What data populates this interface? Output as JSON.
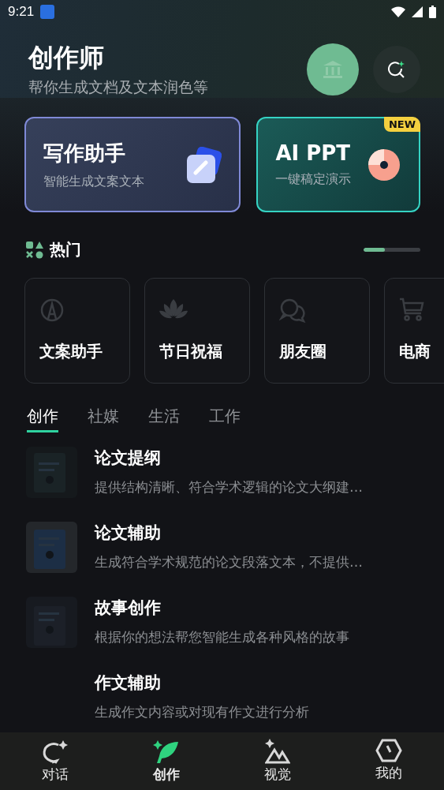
{
  "status_bar": {
    "time": "9:21"
  },
  "header": {
    "title": "创作师",
    "subtitle": "帮你生成文档及文本润色等"
  },
  "feature_cards": [
    {
      "kind": "writer",
      "title": "写作助手",
      "subtitle": "智能生成文案文本"
    },
    {
      "kind": "ppt",
      "title": "AI PPT",
      "subtitle": "一键稿定演示",
      "badge": "NEW"
    }
  ],
  "hot": {
    "title": "热门",
    "scroll": {
      "level": 0.38
    },
    "items": [
      {
        "kind": "pencil",
        "label": "文案助手"
      },
      {
        "kind": "lotus",
        "label": "节日祝福"
      },
      {
        "kind": "chat",
        "label": "朋友圈"
      },
      {
        "kind": "cart",
        "label": "电商"
      }
    ]
  },
  "tabs": [
    {
      "label": "创作",
      "selected": true
    },
    {
      "label": "社媒",
      "selected": false
    },
    {
      "label": "生活",
      "selected": false
    },
    {
      "label": "工作",
      "selected": false
    }
  ],
  "list": [
    {
      "kind": "picture",
      "title": "论文提纲",
      "description": "提供结构清晰、符合学术逻辑的论文大纲建…"
    },
    {
      "kind": "picture",
      "title": "论文辅助",
      "description": "生成符合学术规范的论文段落文本，不提供…"
    },
    {
      "kind": "picture",
      "title": "故事创作",
      "description": "根据你的想法帮您智能生成各种风格的故事"
    },
    {
      "kind": "plain",
      "title": "作文辅助",
      "description": "生成作文内容或对现有作文进行分析"
    }
  ],
  "bottom_nav": [
    {
      "kind": "chat",
      "label": "对话",
      "selected": false
    },
    {
      "kind": "quill",
      "label": "创作",
      "selected": true
    },
    {
      "kind": "mountain",
      "label": "视觉",
      "selected": false
    },
    {
      "kind": "hexagon",
      "label": "我的",
      "selected": false
    }
  ]
}
